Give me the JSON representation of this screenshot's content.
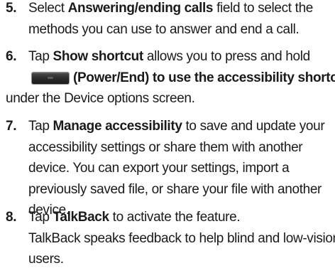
{
  "steps": [
    {
      "number": "5.",
      "lines": [
        [
          "Select ",
          "Answering/ending calls",
          " field to select the"
        ],
        [
          "methods you can use to answer and end a call."
        ]
      ]
    },
    {
      "number": "6.",
      "lines": [
        [
          "Tap ",
          "Show shortcut",
          " allows you to press and hold"
        ],
        [
          "(",
          "Power/End",
          ") to use the accessibility shortcut"
        ],
        [
          "under the Device options screen."
        ]
      ],
      "key_icon": "power-end-key-icon"
    },
    {
      "number": "7.",
      "lines": [
        [
          "Tap ",
          "Manage accessibility",
          " to save and update your"
        ],
        [
          "accessibility settings or share them with another"
        ],
        [
          "device. You can export your settings, import a"
        ],
        [
          "previously saved file, or share your file with another"
        ],
        [
          "device."
        ]
      ]
    },
    {
      "number": "8.",
      "lines": [
        [
          "Tap ",
          "TalkBack",
          " to activate the feature."
        ],
        [
          "TalkBack speaks feedback to help blind and low-vision"
        ],
        [
          "users."
        ]
      ]
    }
  ]
}
